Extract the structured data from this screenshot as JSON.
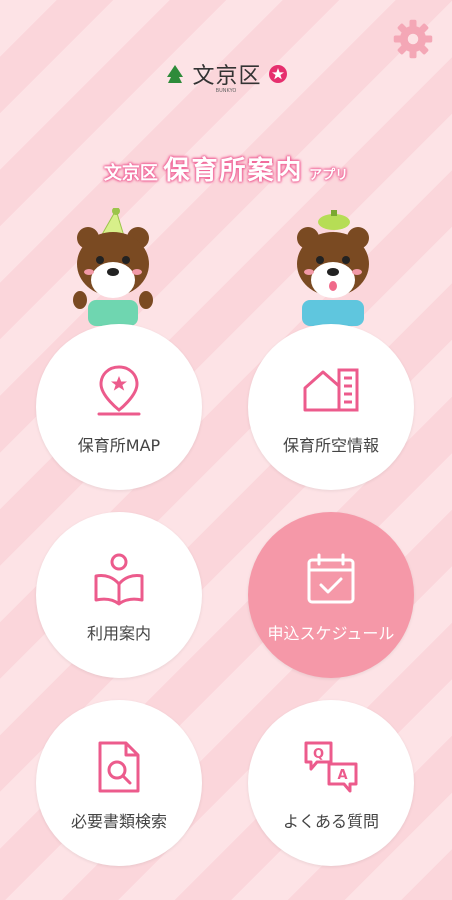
{
  "header": {
    "ward_name": "文京区",
    "ward_sub": "BUNKYO",
    "title_pre": "文京区",
    "title_main": "保育所案内",
    "title_post": "アプリ"
  },
  "colors": {
    "accent": "#f0679a",
    "active_tile": "#f598a8",
    "icon": "#ec5b8c"
  },
  "menu": [
    {
      "label": "保育所MAP",
      "icon": "map-pin-star-icon"
    },
    {
      "label": "保育所空情報",
      "icon": "house-building-icon"
    },
    {
      "label": "利用案内",
      "icon": "person-reading-icon"
    },
    {
      "label": "申込スケジュール",
      "icon": "calendar-check-icon"
    },
    {
      "label": "必要書類検索",
      "icon": "document-search-icon"
    },
    {
      "label": "よくある質問",
      "icon": "qa-bubbles-icon"
    }
  ]
}
